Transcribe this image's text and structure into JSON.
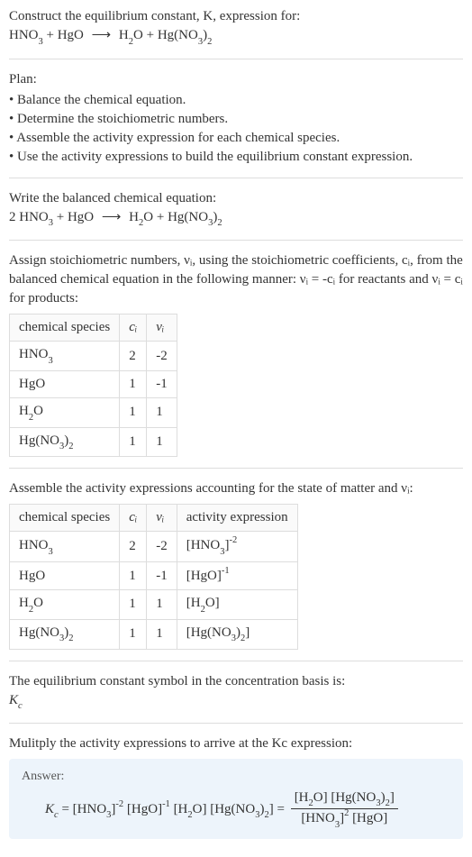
{
  "intro": {
    "line1": "Construct the equilibrium constant, K, expression for:",
    "eq_lhs1": "HNO",
    "eq_lhs1_sub": "3",
    "plus1": " + ",
    "eq_lhs2": "HgO",
    "arrow": "⟶",
    "eq_rhs1": "H",
    "eq_rhs1_sub": "2",
    "eq_rhs1b": "O",
    "plus2": " + ",
    "eq_rhs2": "Hg(NO",
    "eq_rhs2_sub": "3",
    "eq_rhs2b": ")",
    "eq_rhs2_sub2": "2"
  },
  "plan": {
    "title": "Plan:",
    "items": [
      "Balance the chemical equation.",
      "Determine the stoichiometric numbers.",
      "Assemble the activity expression for each chemical species.",
      "Use the activity expressions to build the equilibrium constant expression."
    ]
  },
  "balanced": {
    "title": "Write the balanced chemical equation:",
    "coef1": "2 ",
    "sp1": "HNO",
    "sp1_sub": "3",
    "plus1": " + ",
    "sp2": "HgO",
    "arrow": "⟶",
    "sp3": "H",
    "sp3_sub": "2",
    "sp3b": "O",
    "plus2": " + ",
    "sp4": "Hg(NO",
    "sp4_sub": "3",
    "sp4b": ")",
    "sp4_sub2": "2"
  },
  "stoich": {
    "text": "Assign stoichiometric numbers, νᵢ, using the stoichiometric coefficients, cᵢ, from the balanced chemical equation in the following manner: νᵢ = -cᵢ for reactants and νᵢ = cᵢ for products:",
    "headers": {
      "h1": "chemical species",
      "h2": "cᵢ",
      "h3": "νᵢ"
    },
    "rows": [
      {
        "sp": "HNO",
        "sp_sub": "3",
        "sp2": "",
        "sp_sub2": "",
        "c": "2",
        "v": "-2"
      },
      {
        "sp": "HgO",
        "sp_sub": "",
        "sp2": "",
        "sp_sub2": "",
        "c": "1",
        "v": "-1"
      },
      {
        "sp": "H",
        "sp_sub": "2",
        "sp2": "O",
        "sp_sub2": "",
        "c": "1",
        "v": "1"
      },
      {
        "sp": "Hg(NO",
        "sp_sub": "3",
        "sp2": ")",
        "sp_sub2": "2",
        "c": "1",
        "v": "1"
      }
    ]
  },
  "activity": {
    "title": "Assemble the activity expressions accounting for the state of matter and νᵢ:",
    "headers": {
      "h1": "chemical species",
      "h2": "cᵢ",
      "h3": "νᵢ",
      "h4": "activity expression"
    },
    "rows": [
      {
        "sp": "HNO",
        "sp_sub": "3",
        "sp2": "",
        "sp_sub2": "",
        "c": "2",
        "v": "-2",
        "ae_pre": "[HNO",
        "ae_sub": "3",
        "ae_post": "]",
        "ae_sup": "-2"
      },
      {
        "sp": "HgO",
        "sp_sub": "",
        "sp2": "",
        "sp_sub2": "",
        "c": "1",
        "v": "-1",
        "ae_pre": "[HgO]",
        "ae_sub": "",
        "ae_post": "",
        "ae_sup": "-1"
      },
      {
        "sp": "H",
        "sp_sub": "2",
        "sp2": "O",
        "sp_sub2": "",
        "c": "1",
        "v": "1",
        "ae_pre": "[H",
        "ae_sub": "2",
        "ae_post": "O]",
        "ae_sup": ""
      },
      {
        "sp": "Hg(NO",
        "sp_sub": "3",
        "sp2": ")",
        "sp_sub2": "2",
        "c": "1",
        "v": "1",
        "ae_pre": "[Hg(NO",
        "ae_sub": "3",
        "ae_post": ")",
        "ae_sub2": "2",
        "ae_post2": "]",
        "ae_sup": ""
      }
    ]
  },
  "kc_symbol": {
    "line1": "The equilibrium constant symbol in the concentration basis is:",
    "sym": "K",
    "sym_sub": "c"
  },
  "final": {
    "title": "Mulitply the activity expressions to arrive at the Kc expression:",
    "answer_label": "Answer:",
    "kc": "K",
    "kc_sub": "c",
    "eq": " = ",
    "t1": "[HNO",
    "t1s": "3",
    "t1b": "]",
    "t1e": "-2",
    "t2": " [HgO]",
    "t2e": "-1",
    "t3": " [H",
    "t3s": "2",
    "t3b": "O]",
    "t4": " [Hg(NO",
    "t4s": "3",
    "t4b": ")",
    "t4s2": "2",
    "t4c": "]",
    "eq2": " = ",
    "num1": "[H",
    "num1s": "2",
    "num1b": "O] [Hg(NO",
    "num1s2": "3",
    "num1c": ")",
    "num1s3": "2",
    "num1d": "]",
    "den1": "[HNO",
    "den1s": "3",
    "den1b": "]",
    "den1e": "2",
    "den2": " [HgO]"
  }
}
